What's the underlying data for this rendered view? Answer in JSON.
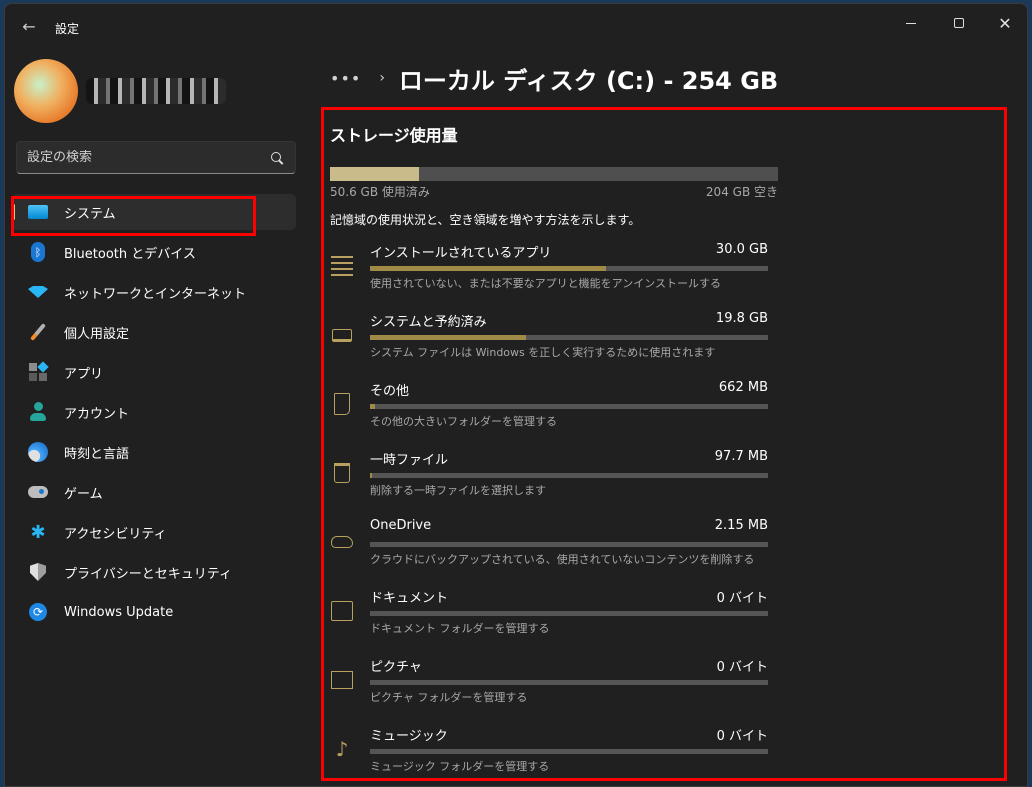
{
  "window": {
    "title": "設定",
    "back_icon": "←",
    "close_icon": "✕"
  },
  "sidebar": {
    "search_placeholder": "設定の検索",
    "items": [
      {
        "label": "システム",
        "icon": "system-icon",
        "active": true
      },
      {
        "label": "Bluetooth とデバイス",
        "icon": "bluetooth-icon"
      },
      {
        "label": "ネットワークとインターネット",
        "icon": "wifi-icon"
      },
      {
        "label": "個人用設定",
        "icon": "paintbrush-icon"
      },
      {
        "label": "アプリ",
        "icon": "apps-icon"
      },
      {
        "label": "アカウント",
        "icon": "account-icon"
      },
      {
        "label": "時刻と言語",
        "icon": "time-language-icon"
      },
      {
        "label": "ゲーム",
        "icon": "gamepad-icon"
      },
      {
        "label": "アクセシビリティ",
        "icon": "accessibility-icon"
      },
      {
        "label": "プライバシーとセキュリティ",
        "icon": "shield-icon"
      },
      {
        "label": "Windows Update",
        "icon": "update-icon"
      }
    ]
  },
  "header": {
    "breadcrumb_more": "•••",
    "breadcrumb_sep": "›",
    "title": "ローカル ディスク (C:) - 254 GB"
  },
  "storage": {
    "section_title": "ストレージ使用量",
    "used_label": "50.6 GB 使用済み",
    "free_label": "204 GB 空き",
    "used_fraction": 0.199,
    "description": "記憶域の使用状況と、空き領域を増やす方法を示します。",
    "colors": {
      "bar_fill": "#c9bb8a",
      "category_fill": "#a08a48",
      "icon": "#b8a060",
      "highlight": "#ff0000"
    },
    "categories": [
      {
        "name": "インストールされているアプリ",
        "size": "30.0 GB",
        "fraction": 0.593,
        "sub": "使用されていない、または不要なアプリと機能をアンインストールする",
        "icon": "app-list-icon"
      },
      {
        "name": "システムと予約済み",
        "size": "19.8 GB",
        "fraction": 0.391,
        "sub": "システム ファイルは Windows を正しく実行するために使用されます",
        "icon": "laptop-icon"
      },
      {
        "name": "その他",
        "size": "662 MB",
        "fraction": 0.013,
        "sub": "その他の大きいフォルダーを管理する",
        "icon": "other-folder-icon"
      },
      {
        "name": "一時ファイル",
        "size": "97.7 MB",
        "fraction": 0.002,
        "sub": "削除する一時ファイルを選択します",
        "icon": "trash-icon"
      },
      {
        "name": "OneDrive",
        "size": "2.15 MB",
        "fraction": 0.0,
        "sub": "クラウドにバックアップされている、使用されていないコンテンツを削除する",
        "icon": "cloud-icon"
      },
      {
        "name": "ドキュメント",
        "size": "0 バイト",
        "fraction": 0.0,
        "sub": "ドキュメント フォルダーを管理する",
        "icon": "documents-folder-icon"
      },
      {
        "name": "ピクチャ",
        "size": "0 バイト",
        "fraction": 0.0,
        "sub": "ピクチャ フォルダーを管理する",
        "icon": "picture-icon"
      },
      {
        "name": "ミュージック",
        "size": "0 バイト",
        "fraction": 0.0,
        "sub": "ミュージック フォルダーを管理する",
        "icon": "music-note-icon"
      }
    ]
  }
}
